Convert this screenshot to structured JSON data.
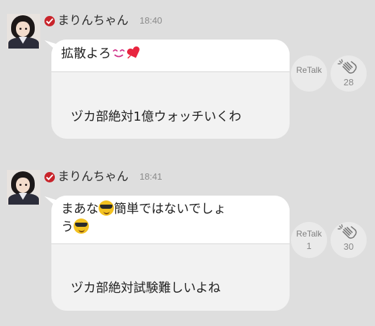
{
  "posts": [
    {
      "author": "まりんちゃん",
      "time": "18:40",
      "message_text": "拡散よろ",
      "message_emojis": [
        "smiling-eyes-emoji",
        "sparkling-heart-emoji"
      ],
      "reply_text": "ヅカ部絶対1億ウォッチいくわ",
      "retalk_label": "ReTalk",
      "retalk_count": "",
      "clap_count": "28"
    },
    {
      "author": "まりんちゃん",
      "time": "18:41",
      "message_line1": "まあな",
      "message_line1_after": "簡単ではないでしょ",
      "message_line2": "う",
      "message_emojis": [
        "sunglasses-emoji"
      ],
      "reply_text": "ヅカ部絶対試験難しいよね",
      "retalk_label": "ReTalk",
      "retalk_count": "1",
      "clap_count": "30"
    }
  ],
  "colors": {
    "background": "#dedede",
    "badge": "#c8242b",
    "bubble_top": "#ffffff",
    "bubble_bottom": "#f2f2f2"
  }
}
